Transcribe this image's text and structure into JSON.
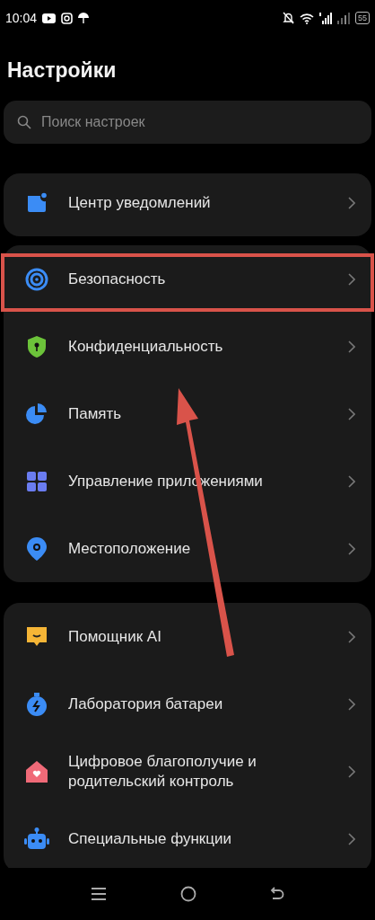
{
  "status_bar": {
    "time": "10:04",
    "battery": "55"
  },
  "title": "Настройки",
  "search": {
    "placeholder": "Поиск настроек"
  },
  "groups": [
    {
      "items": [
        {
          "label": "Центр уведомлений",
          "highlighted": false
        }
      ]
    },
    {
      "items": [
        {
          "label": "Безопасность",
          "highlighted": true
        },
        {
          "label": "Конфиденциальность",
          "highlighted": false
        },
        {
          "label": "Память",
          "highlighted": false
        },
        {
          "label": "Управление приложениями",
          "highlighted": false
        },
        {
          "label": "Местоположение",
          "highlighted": false
        }
      ]
    },
    {
      "items": [
        {
          "label": "Помощник AI",
          "highlighted": false
        },
        {
          "label": "Лаборатория батареи",
          "highlighted": false
        },
        {
          "label": "Цифровое благополучие и родительский контроль",
          "highlighted": false
        },
        {
          "label": "Специальные функции",
          "highlighted": false
        }
      ]
    }
  ]
}
